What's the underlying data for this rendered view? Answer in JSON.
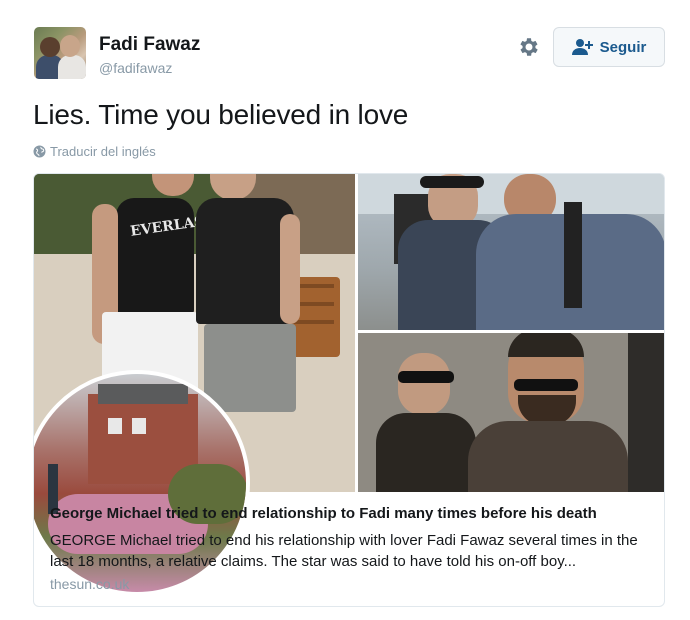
{
  "tweet": {
    "author_name": "Fadi Fawaz",
    "author_handle": "@fadifawaz",
    "text": "Lies. Time you believed in love",
    "translate_label": "Traducir del inglés"
  },
  "follow_button": {
    "label": "Seguir"
  },
  "icons": {
    "settings": "gear-icon",
    "follow": "add-user-icon",
    "translate": "globe-icon"
  },
  "card": {
    "title": "George Michael tried to end relationship to Fadi many times before his death",
    "description": "GEORGE Michael tried to end his relationship with lover Fadi Fawaz several times in the last 18 months, a relative claims. The star was said to have told his on-off boy...",
    "domain": "thesun.co.uk",
    "image_text": "EVERLAST"
  },
  "colors": {
    "accent": "#1b5a8e",
    "secondary_text": "#8899a6",
    "border": "#e1e8ed"
  }
}
